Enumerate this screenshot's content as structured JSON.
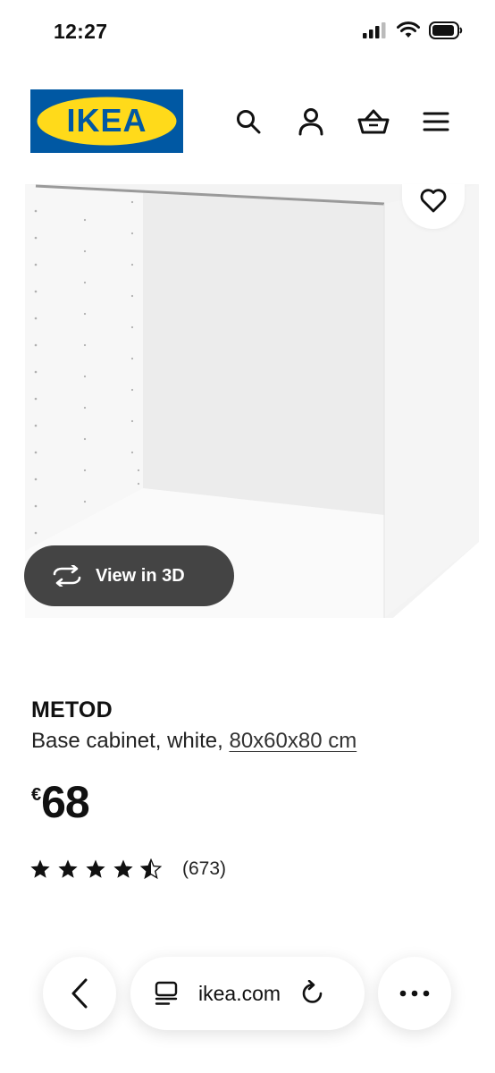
{
  "status_bar": {
    "time": "12:27",
    "icons": [
      "signal-icon",
      "wifi-icon",
      "battery-icon"
    ]
  },
  "header": {
    "logo_text": "IKEA",
    "logo_colors": {
      "blue": "#0058A3",
      "yellow": "#FFDA1A"
    },
    "icons": [
      "search-icon",
      "account-icon",
      "cart-icon",
      "menu-icon"
    ]
  },
  "product": {
    "view_3d_label": "View in 3D",
    "name": "METOD",
    "description": "Base cabinet, white,",
    "size": "80x60x80 cm",
    "price_currency": "€",
    "price_amount": "68",
    "rating_stars": 4.5,
    "rating_max": 5,
    "rating_count": "(673)"
  },
  "browser": {
    "url": "ikea.com",
    "icons": [
      "back-icon",
      "reader-icon",
      "reload-icon",
      "more-icon"
    ]
  }
}
